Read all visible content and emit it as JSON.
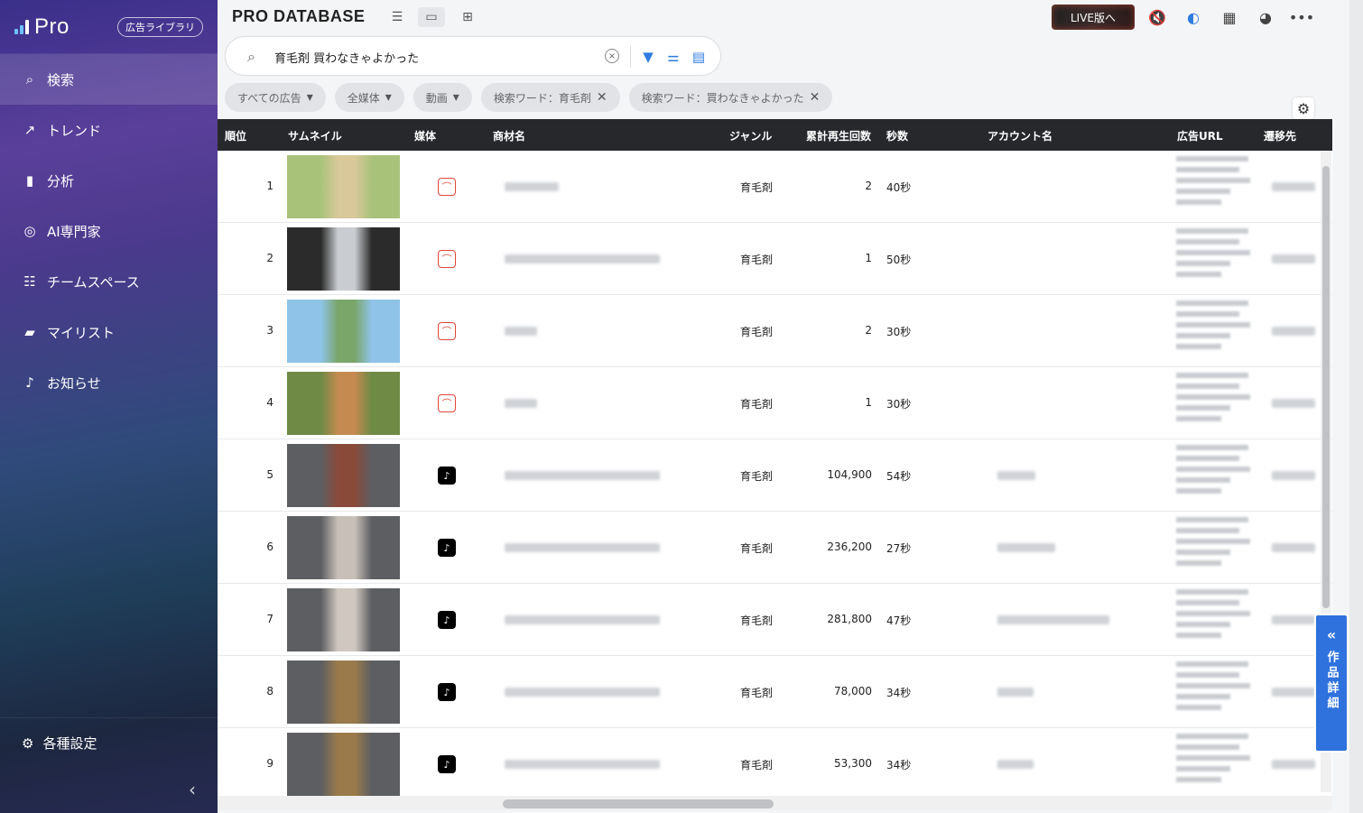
{
  "sidebar": {
    "logo": "Pro",
    "badge": "広告ライブラリ",
    "items": [
      {
        "label": "検索",
        "icon": "search-icon"
      },
      {
        "label": "トレンド",
        "icon": "trend-icon"
      },
      {
        "label": "分析",
        "icon": "bar-chart-icon"
      },
      {
        "label": "AI専門家",
        "icon": "ai-icon"
      },
      {
        "label": "チームスペース",
        "icon": "team-icon"
      },
      {
        "label": "マイリスト",
        "icon": "bookmark-icon"
      },
      {
        "label": "お知らせ",
        "icon": "bell-icon"
      }
    ],
    "settings": "各種設定"
  },
  "header": {
    "title": "PRO DATABASE",
    "live_button": "LIVE版へ"
  },
  "search": {
    "value": "育毛剤 買わなきゃよかった",
    "clear_glyph": "×"
  },
  "chips": [
    {
      "label": "すべての広告",
      "type": "dropdown"
    },
    {
      "label": "全媒体",
      "type": "dropdown"
    },
    {
      "label": "動画",
      "type": "dropdown"
    },
    {
      "label": "検索ワード：育毛剤",
      "type": "removable"
    },
    {
      "label": "検索ワード：買わなきゃよかった",
      "type": "removable"
    }
  ],
  "table": {
    "columns": [
      "順位",
      "サムネイル",
      "媒体",
      "商材名",
      "ジャンル",
      "累計再生回数",
      "秒数",
      "アカウント名",
      "広告URL",
      "遷移先"
    ],
    "rows": [
      {
        "rank": "1",
        "media": "red",
        "genre": "育毛剤",
        "views": "2",
        "seconds": "40秒"
      },
      {
        "rank": "2",
        "media": "red",
        "genre": "育毛剤",
        "views": "1",
        "seconds": "50秒"
      },
      {
        "rank": "3",
        "media": "red",
        "genre": "育毛剤",
        "views": "2",
        "seconds": "30秒"
      },
      {
        "rank": "4",
        "media": "red",
        "genre": "育毛剤",
        "views": "1",
        "seconds": "30秒"
      },
      {
        "rank": "5",
        "media": "tiktok",
        "genre": "育毛剤",
        "views": "104,900",
        "seconds": "54秒"
      },
      {
        "rank": "6",
        "media": "tiktok",
        "genre": "育毛剤",
        "views": "236,200",
        "seconds": "27秒"
      },
      {
        "rank": "7",
        "media": "tiktok",
        "genre": "育毛剤",
        "views": "281,800",
        "seconds": "47秒"
      },
      {
        "rank": "8",
        "media": "tiktok",
        "genre": "育毛剤",
        "views": "78,000",
        "seconds": "34秒"
      },
      {
        "rank": "9",
        "media": "tiktok",
        "genre": "育毛剤",
        "views": "53,300",
        "seconds": "34秒"
      }
    ]
  },
  "detail_tab": "作品詳細",
  "colors": {
    "accent": "#2f72de",
    "header_bg": "#26282c",
    "tiktok": "#000000",
    "media_red": "#e0453a"
  }
}
